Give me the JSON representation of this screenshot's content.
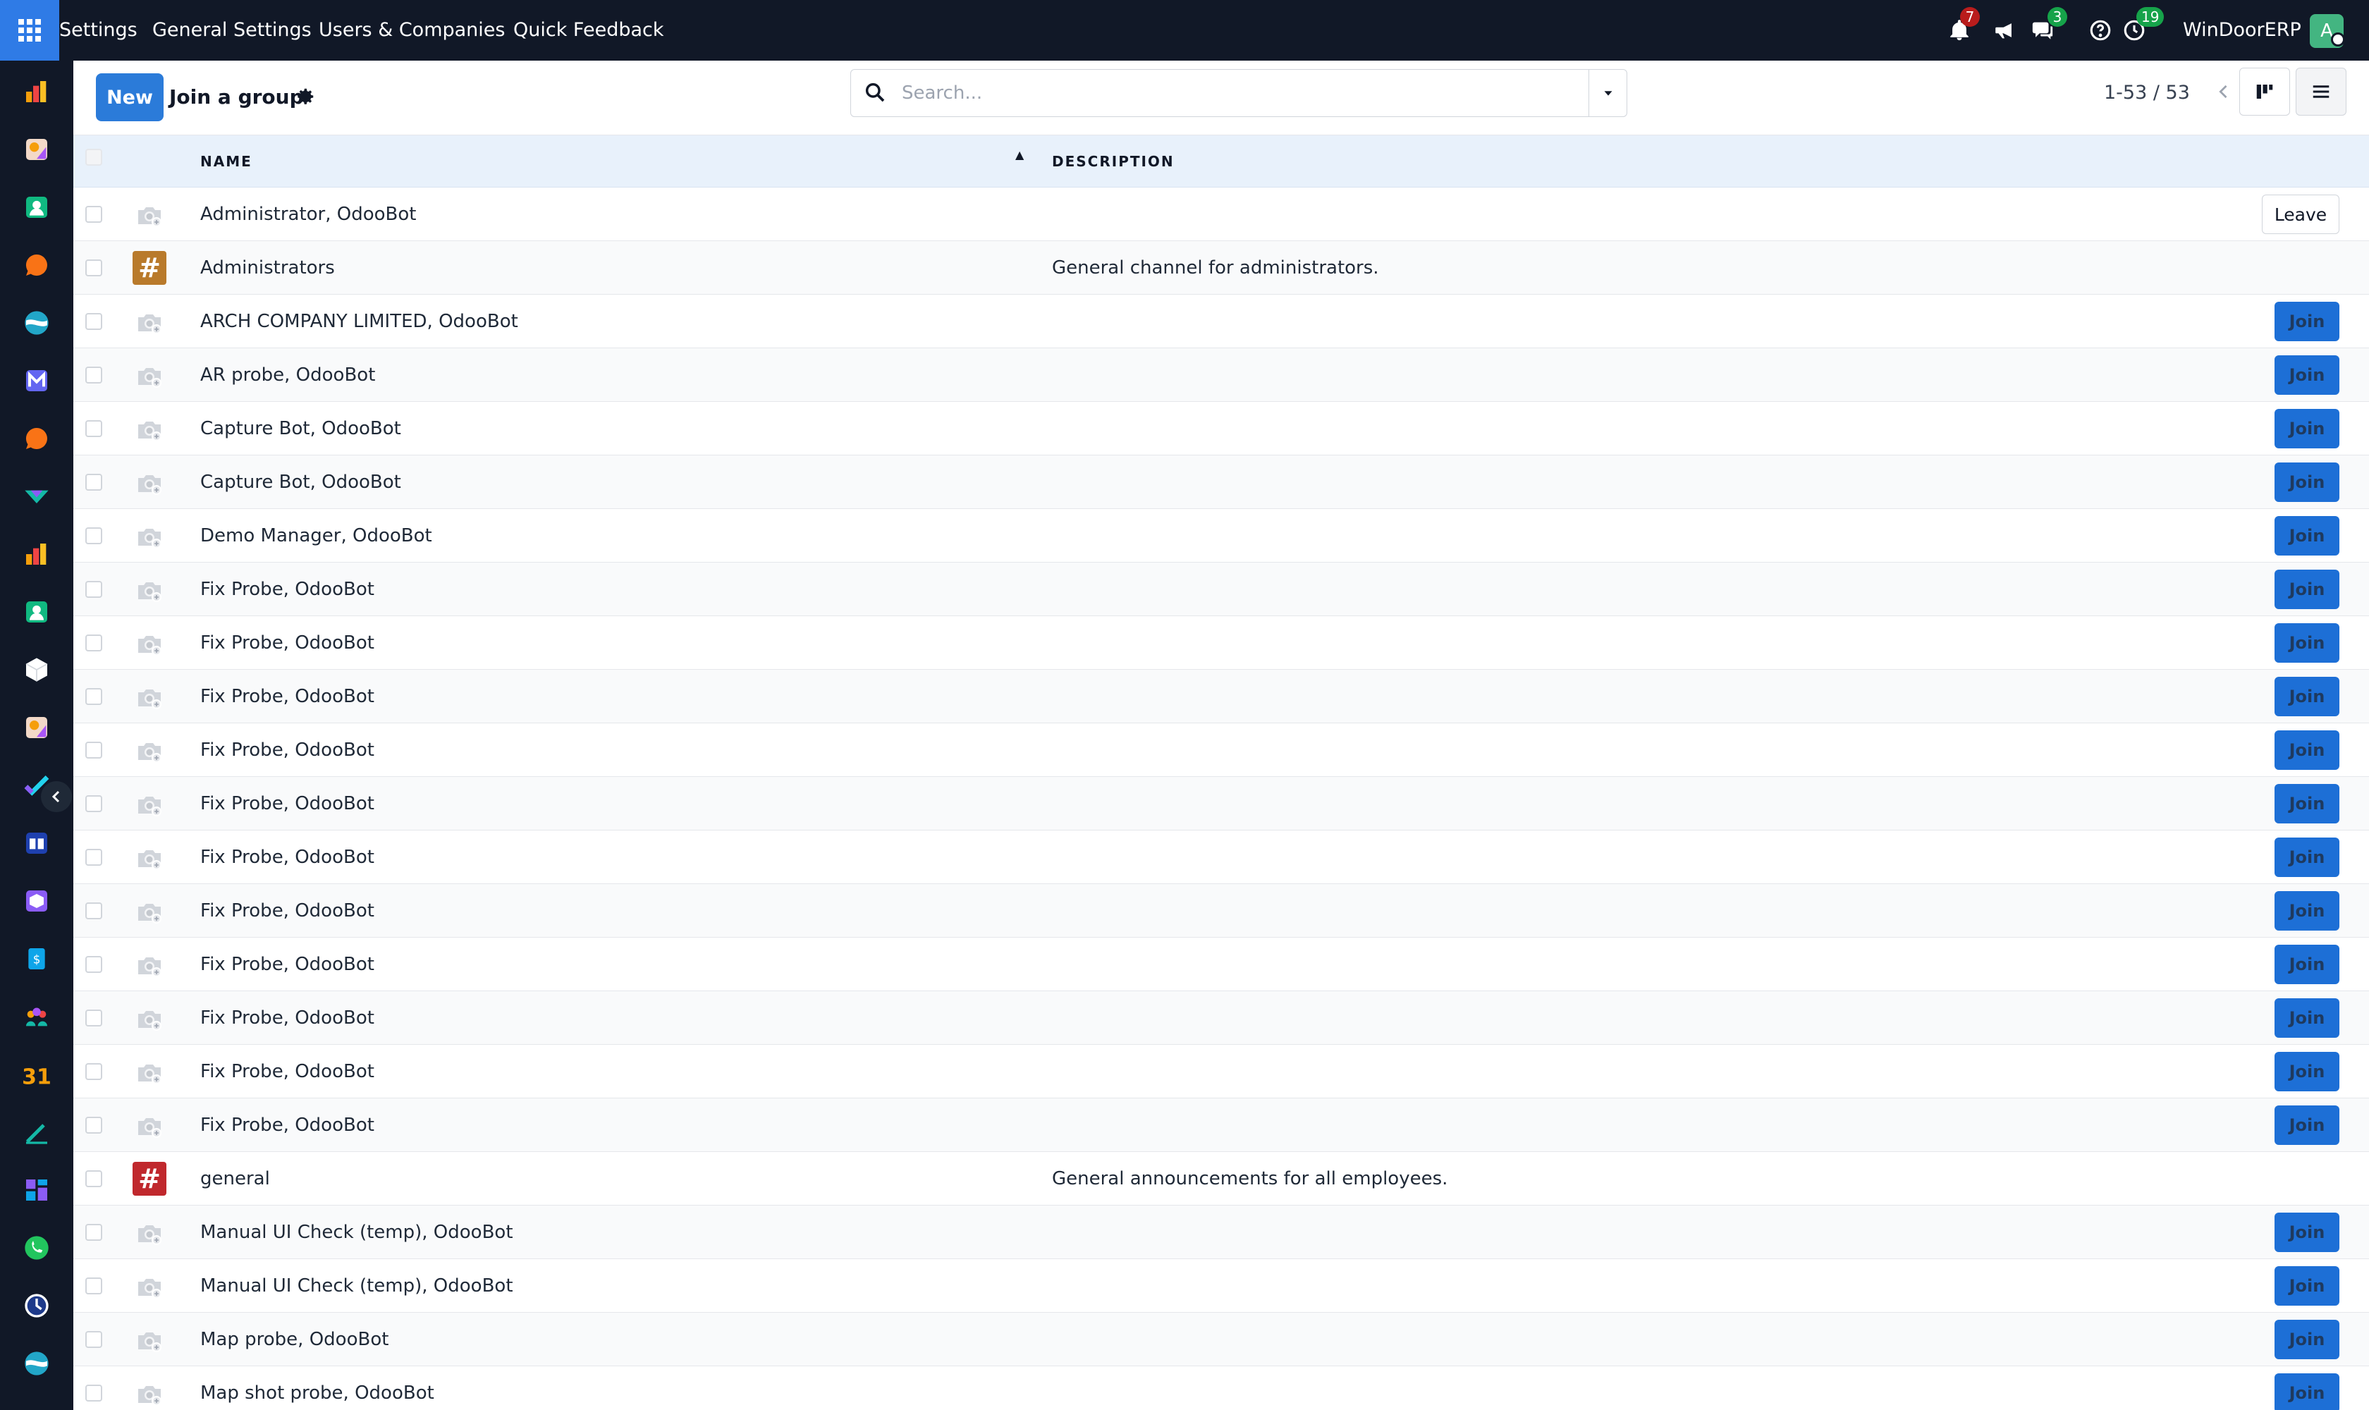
{
  "topbar": {
    "apps_icon": "grid-icon",
    "menu": [
      "Settings",
      "General Settings",
      "Users & Companies",
      "Quick Feedback"
    ],
    "notifications_badge": "7",
    "messages_badge": "3",
    "activities_badge": "19",
    "company": "WinDoorERP",
    "avatar_letter": "A",
    "colors": {
      "bar": "#111827",
      "apps": "#2f7be6",
      "badge_red": "#b91c1c",
      "badge_green": "#16a34a"
    }
  },
  "sidebar": {
    "icons": [
      "sales-icon",
      "studio-icon",
      "contacts-icon",
      "discuss-icon",
      "crm-icon",
      "email-marketing-icon",
      "chat-icon",
      "inventory-icon",
      "dashboards-icon",
      "employees-icon",
      "products-icon",
      "studio-icon",
      "project-icon",
      "knowledge-icon",
      "documents-icon",
      "invoicing-icon",
      "team-icon",
      "calendar-icon",
      "sign-icon",
      "apps-icon",
      "whatsapp-icon",
      "timesheet-icon",
      "planning-icon"
    ],
    "calendar_label": "31"
  },
  "control_panel": {
    "new_label": "New",
    "title": "Join a group",
    "search_placeholder": "Search...",
    "pager": "1-53 / 53",
    "accent": "#2b7bd9"
  },
  "list": {
    "columns": {
      "name": "NAME",
      "description": "DESCRIPTION"
    },
    "rows": [
      {
        "name": "Administrator, OdooBot",
        "description": "",
        "avatar": "group-avatar-icon",
        "action": "Leave"
      },
      {
        "name": "Administrators",
        "description": "General channel for administrators.",
        "avatar": "hash-icon",
        "avatar_color": "#b97a2b",
        "action": ""
      },
      {
        "name": "ARCH COMPANY LIMITED, OdooBot",
        "description": "",
        "avatar": "group-avatar-icon",
        "action": "Join"
      },
      {
        "name": "AR probe, OdooBot",
        "description": "",
        "avatar": "group-avatar-icon",
        "action": "Join"
      },
      {
        "name": "Capture Bot, OdooBot",
        "description": "",
        "avatar": "group-avatar-icon",
        "action": "Join"
      },
      {
        "name": "Capture Bot, OdooBot",
        "description": "",
        "avatar": "group-avatar-icon",
        "action": "Join"
      },
      {
        "name": "Demo Manager, OdooBot",
        "description": "",
        "avatar": "group-avatar-icon",
        "action": "Join"
      },
      {
        "name": "Fix Probe, OdooBot",
        "description": "",
        "avatar": "group-avatar-icon",
        "action": "Join"
      },
      {
        "name": "Fix Probe, OdooBot",
        "description": "",
        "avatar": "group-avatar-icon",
        "action": "Join"
      },
      {
        "name": "Fix Probe, OdooBot",
        "description": "",
        "avatar": "group-avatar-icon",
        "action": "Join"
      },
      {
        "name": "Fix Probe, OdooBot",
        "description": "",
        "avatar": "group-avatar-icon",
        "action": "Join"
      },
      {
        "name": "Fix Probe, OdooBot",
        "description": "",
        "avatar": "group-avatar-icon",
        "action": "Join"
      },
      {
        "name": "Fix Probe, OdooBot",
        "description": "",
        "avatar": "group-avatar-icon",
        "action": "Join"
      },
      {
        "name": "Fix Probe, OdooBot",
        "description": "",
        "avatar": "group-avatar-icon",
        "action": "Join"
      },
      {
        "name": "Fix Probe, OdooBot",
        "description": "",
        "avatar": "group-avatar-icon",
        "action": "Join"
      },
      {
        "name": "Fix Probe, OdooBot",
        "description": "",
        "avatar": "group-avatar-icon",
        "action": "Join"
      },
      {
        "name": "Fix Probe, OdooBot",
        "description": "",
        "avatar": "group-avatar-icon",
        "action": "Join"
      },
      {
        "name": "Fix Probe, OdooBot",
        "description": "",
        "avatar": "group-avatar-icon",
        "action": "Join"
      },
      {
        "name": "general",
        "description": "General announcements for all employees.",
        "avatar": "hash-icon",
        "avatar_color": "#c0282d",
        "action": ""
      },
      {
        "name": "Manual UI Check (temp), OdooBot",
        "description": "",
        "avatar": "group-avatar-icon",
        "action": "Join"
      },
      {
        "name": "Manual UI Check (temp), OdooBot",
        "description": "",
        "avatar": "group-avatar-icon",
        "action": "Join"
      },
      {
        "name": "Map probe, OdooBot",
        "description": "",
        "avatar": "group-avatar-icon",
        "action": "Join"
      },
      {
        "name": "Map shot probe, OdooBot",
        "description": "",
        "avatar": "group-avatar-icon",
        "action": "Join"
      }
    ]
  }
}
